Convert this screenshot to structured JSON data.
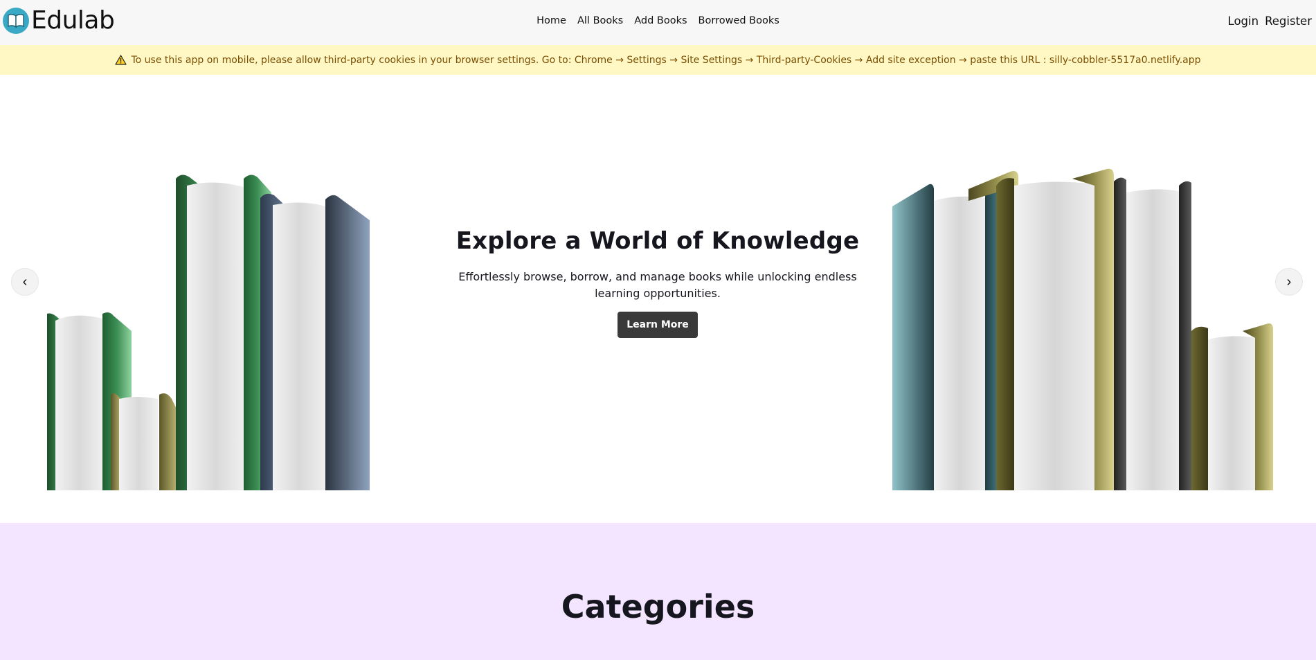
{
  "brand": {
    "name": "Edulab",
    "logo_icon": "open-book-icon"
  },
  "nav": {
    "links": [
      "Home",
      "All Books",
      "Add Books",
      "Borrowed Books"
    ],
    "login": "Login",
    "register": "Register"
  },
  "notice": {
    "icon": "warning-icon",
    "text": "To use this app on mobile, please allow third-party cookies in your browser settings. Go to: Chrome → Settings → Site Settings → Third-party-Cookies → Add site exception → paste this URL : silly-cobbler-5517a0.netlify.app"
  },
  "hero": {
    "title": "Explore a World of Knowledge",
    "subtitle": "Effortlessly browse, borrow, and manage books while unlocking endless learning opportunities.",
    "button": "Learn More",
    "prev_symbol": "‹",
    "next_symbol": "›"
  },
  "categories": {
    "title": "Categories"
  },
  "colors": {
    "navbar_bg": "#f7f7f7",
    "notice_bg": "#fff8c4",
    "notice_text": "#7a4d00",
    "categories_bg": "#f3e5ff",
    "button_bg": "#3a3a3a",
    "logo": "#3aa9c5"
  }
}
